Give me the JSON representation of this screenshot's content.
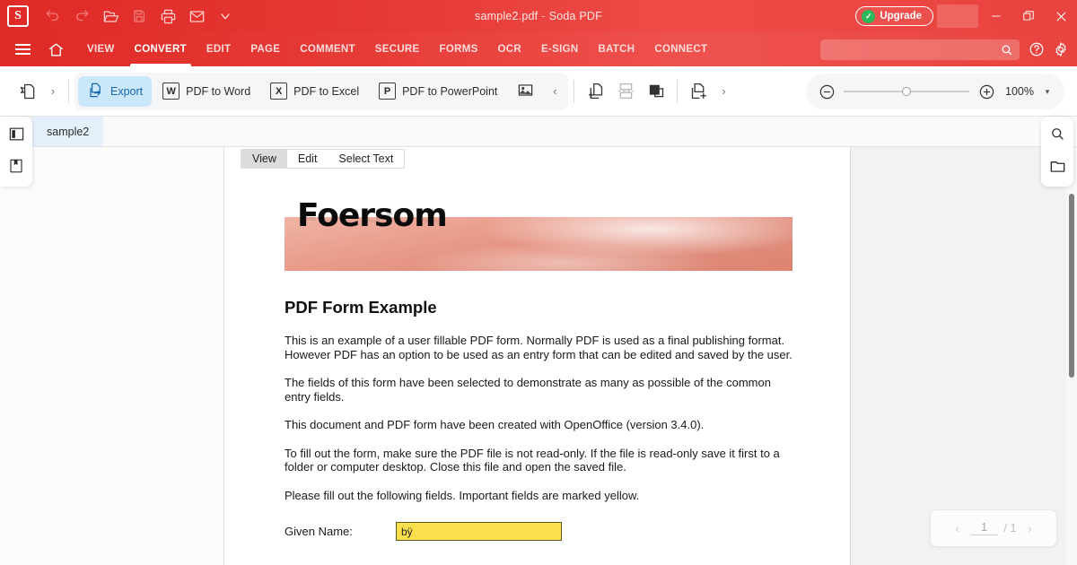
{
  "titlebar": {
    "app_logo": "S",
    "document_title": "sample2.pdf",
    "separator": "-",
    "app_name": "Soda PDF",
    "upgrade_label": "Upgrade",
    "icons": [
      "undo-icon",
      "redo-icon",
      "open-folder-icon",
      "save-icon",
      "print-icon",
      "email-icon",
      "chevron-down-icon"
    ],
    "window_controls": [
      "minimize",
      "maximize",
      "close"
    ]
  },
  "menubar": {
    "items": [
      {
        "label": "VIEW",
        "active": false
      },
      {
        "label": "CONVERT",
        "active": true
      },
      {
        "label": "EDIT",
        "active": false
      },
      {
        "label": "PAGE",
        "active": false
      },
      {
        "label": "COMMENT",
        "active": false
      },
      {
        "label": "SECURE",
        "active": false
      },
      {
        "label": "FORMS",
        "active": false
      },
      {
        "label": "OCR",
        "active": false
      },
      {
        "label": "E-SIGN",
        "active": false
      },
      {
        "label": "BATCH",
        "active": false
      },
      {
        "label": "CONNECT",
        "active": false
      }
    ],
    "search": {
      "value": "",
      "placeholder": ""
    }
  },
  "ribbon": {
    "export_label": "Export",
    "pdf_to_word_label": "PDF to Word",
    "pdf_to_word_badge": "W",
    "pdf_to_excel_label": "PDF to Excel",
    "pdf_to_excel_badge": "X",
    "pdf_to_powerpoint_label": "PDF to PowerPoint",
    "pdf_to_powerpoint_badge": "P",
    "collapse_left": "‹",
    "collapse_right": "›",
    "overflow_chevron": "›",
    "zoom": {
      "value": "100%",
      "minus": "−",
      "plus": "+",
      "caret": "▾"
    }
  },
  "tabs": {
    "open_documents": [
      {
        "label": "sample2",
        "active": true
      }
    ]
  },
  "viewmodes": {
    "options": [
      {
        "label": "View",
        "selected": true
      },
      {
        "label": "Edit",
        "selected": false
      },
      {
        "label": "Select Text",
        "selected": false
      }
    ]
  },
  "document": {
    "banner_word": "Foersom",
    "heading": "PDF Form Example",
    "paragraphs": [
      "This is an example of a user fillable PDF form. Normally PDF is used as a final publishing format. However PDF has an option to be used as an entry form that can be edited and saved by the user.",
      "The fields of this form have been selected to demonstrate as many as possible of the common entry fields.",
      "This document and PDF form have been created with OpenOffice (version 3.4.0).",
      "To fill out the form, make sure the PDF file is not read-only. If the file is read-only save it first to a folder or computer desktop. Close this file and open the saved file.",
      "Please fill out the following fields. Important fields are marked yellow."
    ],
    "fields": [
      {
        "label": "Given Name:",
        "value": "bÿ",
        "highlight": "#fbe04c"
      }
    ]
  },
  "pagenav": {
    "prev": "‹",
    "next": "›",
    "current_page": "1",
    "total_pages": "/ 1"
  },
  "colors": {
    "brand_red": "#e53935",
    "accent_blue": "#cbe7fb",
    "tab_blue": "#e4f0fb",
    "field_yellow": "#fbe04c",
    "banner_salmon": "#e79685"
  }
}
